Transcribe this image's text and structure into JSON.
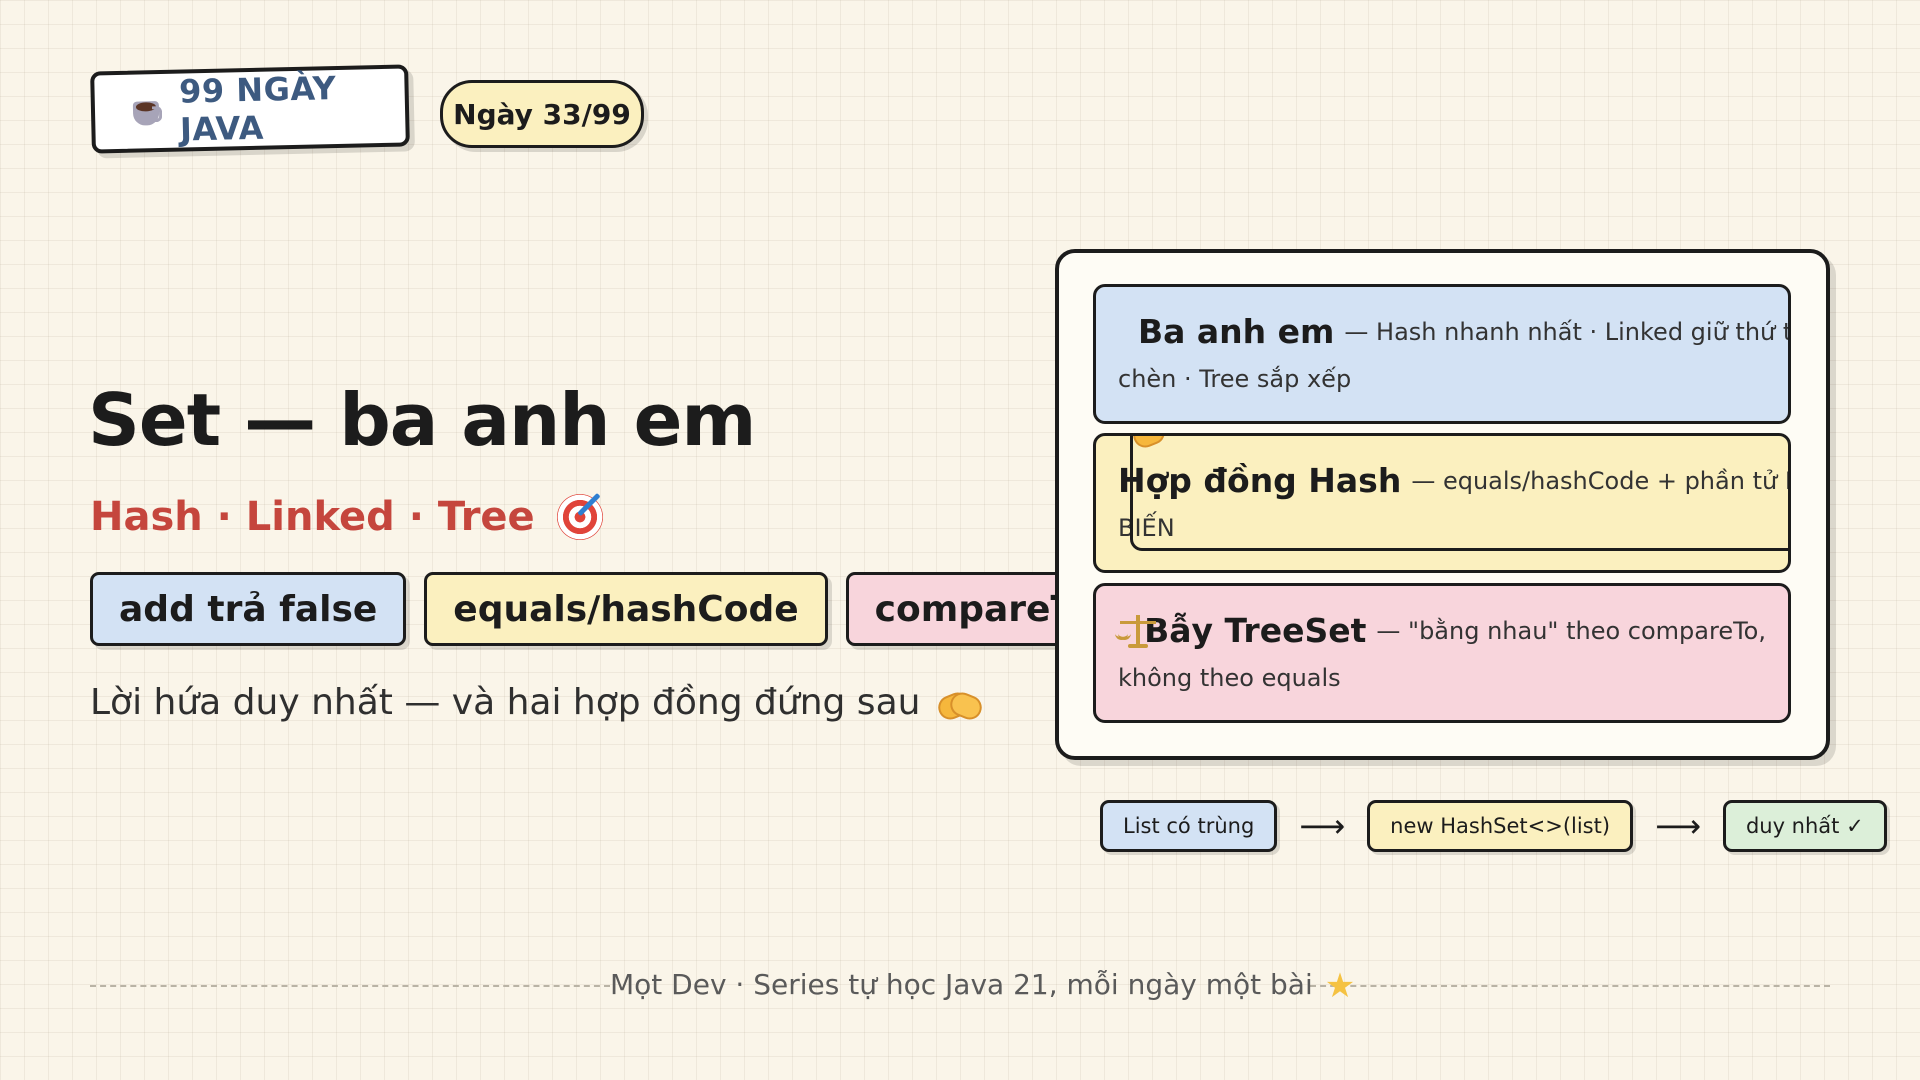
{
  "header": {
    "series_badge": "99 NGÀY JAVA",
    "day_badge": "Ngày 33/99"
  },
  "hero": {
    "title": "Set — ba anh em",
    "subtitle": "Hash · Linked · Tree",
    "chips": [
      {
        "label": "add trả false",
        "color": "#d3e2f4"
      },
      {
        "label": "equals/hashCode",
        "color": "#fbf0bf"
      },
      {
        "label": "compareTo",
        "color": "#f8d5dc"
      }
    ],
    "tagline": "Lời hứa duy nhất — và hai hợp đồng đứng sau"
  },
  "card": {
    "rows": [
      {
        "icon": "target-icon",
        "title": "Ba anh em",
        "desc": "— Hash nhanh nhất · Linked giữ thứ tự",
        "cont": "chèn · Tree sắp xếp",
        "color": "#d3e2f4"
      },
      {
        "icon": "handshake-icon",
        "title": "Hợp đồng Hash",
        "desc": "— equals/hashCode + phần tử BẤT",
        "cont": "BIẾN",
        "color": "#fbf0bf"
      },
      {
        "icon": "scale-icon",
        "title": "Bẫy TreeSet",
        "desc": "— \"bằng nhau\" theo compareTo,",
        "cont": "không theo equals",
        "color": "#f8d5dc"
      }
    ]
  },
  "flow": {
    "steps": [
      "List có trùng",
      "new HashSet<>(list)",
      "duy nhất ✓"
    ],
    "arrow": "⟶"
  },
  "footer": {
    "text": "Mọt Dev · Series tự học Java 21, mỗi ngày một bài",
    "star": "★"
  },
  "colors": {
    "background": "#faf5e9",
    "accent_red": "#c5463d",
    "accent_blue": "#3d5a80",
    "ink": "#1c1c1c"
  }
}
